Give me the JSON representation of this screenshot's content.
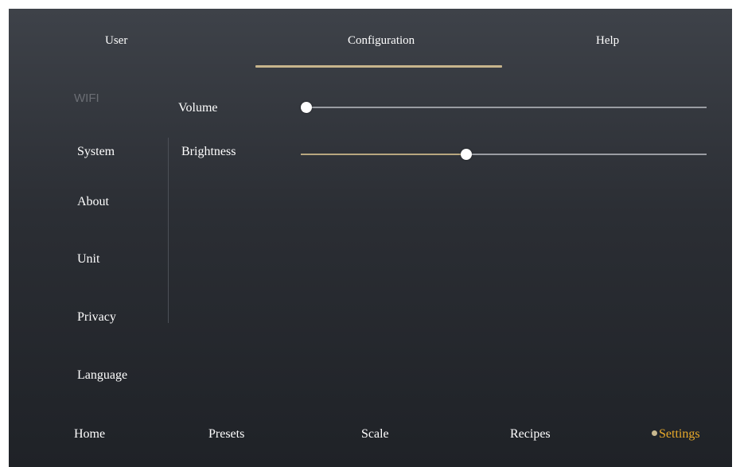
{
  "top_tabs": [
    {
      "label": "User"
    },
    {
      "label": "Configuration",
      "selected": true
    },
    {
      "label": "Help"
    }
  ],
  "sidebar": {
    "items": [
      {
        "label": "WIFI",
        "disabled": true
      },
      {
        "label": "System"
      },
      {
        "label": "About"
      },
      {
        "label": "Unit"
      },
      {
        "label": "Privacy"
      },
      {
        "label": "Language"
      }
    ]
  },
  "settings": {
    "volume": {
      "label": "Volume",
      "level": 0.0
    },
    "brightness": {
      "label": "Brightness",
      "level": 0.4
    }
  },
  "bottom_nav": [
    {
      "label": "Home"
    },
    {
      "label": "Presets"
    },
    {
      "label": "Scale"
    },
    {
      "label": "Recipes"
    },
    {
      "label": "Settings",
      "active": true
    }
  ],
  "colors": {
    "accent_underline": "#c7b58c",
    "active_nav": "#e7a92a",
    "slider_fill": "#b8a77f",
    "disabled_text": "#6b6e74"
  }
}
